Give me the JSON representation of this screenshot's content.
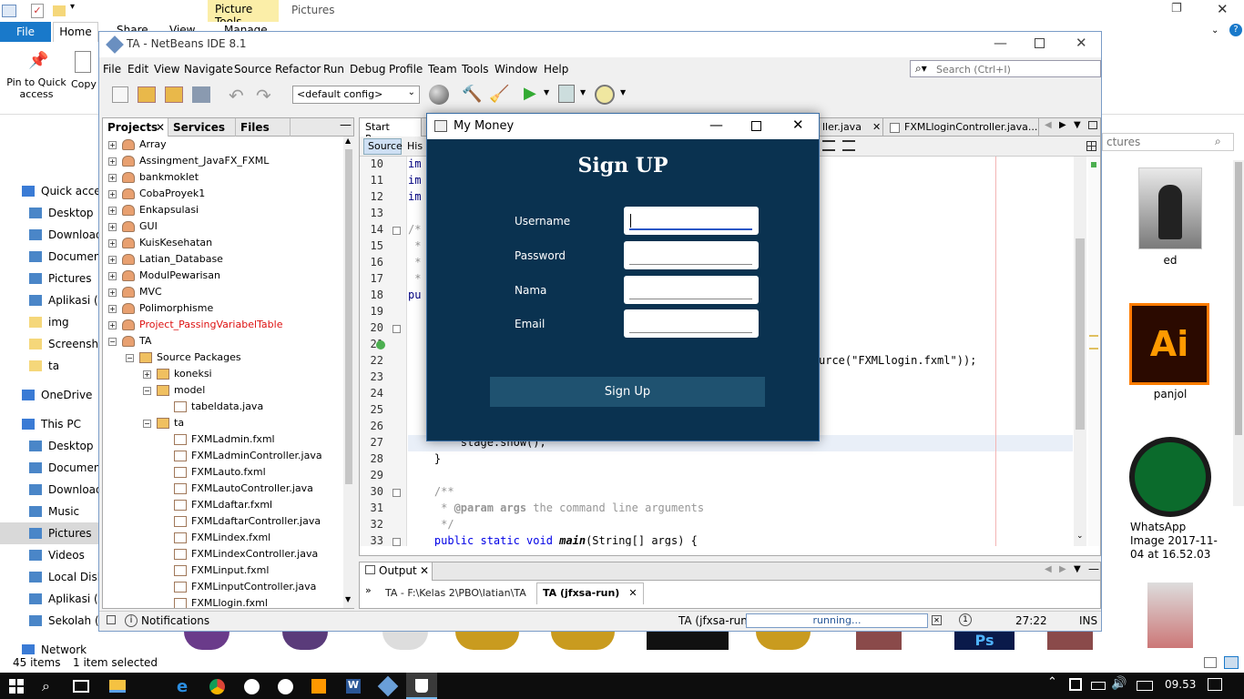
{
  "explorer": {
    "ribbon_tabs": {
      "file": "File",
      "home": "Home",
      "share": "Share",
      "view": "View",
      "manage": "Manage"
    },
    "contextual_tab": "Picture Tools",
    "window_title": "Pictures",
    "ribbon": {
      "pin_label": "Pin to Quick access",
      "copy_label": "Copy"
    },
    "nav": [
      {
        "label": "Quick access",
        "type": "header"
      },
      {
        "label": "Desktop"
      },
      {
        "label": "Downloads"
      },
      {
        "label": "Documents"
      },
      {
        "label": "Pictures"
      },
      {
        "label": "Aplikasi (E:"
      },
      {
        "label": "img"
      },
      {
        "label": "Screenshots"
      },
      {
        "label": "ta"
      },
      {
        "label": "OneDrive",
        "type": "header"
      },
      {
        "label": "This PC",
        "type": "header"
      },
      {
        "label": "Desktop"
      },
      {
        "label": "Documents"
      },
      {
        "label": "Downloads"
      },
      {
        "label": "Music"
      },
      {
        "label": "Pictures",
        "selected": true
      },
      {
        "label": "Videos"
      },
      {
        "label": "Local Disk"
      },
      {
        "label": "Aplikasi (E:"
      },
      {
        "label": "Sekolah (F:"
      },
      {
        "label": "Network",
        "type": "header"
      }
    ],
    "search_placeholder": "Search Pictures",
    "search_visible_text": "ctures",
    "files_right": [
      {
        "name": "ed"
      },
      {
        "name": "panjol"
      },
      {
        "name": "WhatsApp Image 2017-11-04 at 16.52.03"
      }
    ],
    "status": {
      "items": "45 items",
      "selected": "1 item selected"
    }
  },
  "netbeans": {
    "title": "TA - NetBeans IDE 8.1",
    "menu": [
      "File",
      "Edit",
      "View",
      "Navigate",
      "Source",
      "Refactor",
      "Run",
      "Debug",
      "Profile",
      "Team",
      "Tools",
      "Window",
      "Help"
    ],
    "search_placeholder": "Search (Ctrl+I)",
    "config_select": "<default config>",
    "project_tabs": [
      "Projects",
      "Services",
      "Files"
    ],
    "projects": [
      {
        "label": "Array"
      },
      {
        "label": "Assingment_JavaFX_FXML"
      },
      {
        "label": "bankmoklet"
      },
      {
        "label": "CobaProyek1"
      },
      {
        "label": "Enkapsulasi"
      },
      {
        "label": "GUI"
      },
      {
        "label": "KuisKesehatan"
      },
      {
        "label": "Latian_Database"
      },
      {
        "label": "ModulPewarisan"
      },
      {
        "label": "MVC"
      },
      {
        "label": "Polimorphisme"
      },
      {
        "label": "Project_PassingVariabelTable",
        "error": true
      },
      {
        "label": "TA",
        "expanded": true
      }
    ],
    "ta_tree": [
      {
        "label": "Source Packages",
        "level": 1
      },
      {
        "label": "koneksi",
        "level": 2
      },
      {
        "label": "model",
        "level": 2
      },
      {
        "label": "tabeldata.java",
        "level": 3
      },
      {
        "label": "ta",
        "level": 2
      },
      {
        "label": "FXMLadmin.fxml",
        "level": 3
      },
      {
        "label": "FXMLadminController.java",
        "level": 3
      },
      {
        "label": "FXMLauto.fxml",
        "level": 3
      },
      {
        "label": "FXMLautoController.java",
        "level": 3
      },
      {
        "label": "FXMLdaftar.fxml",
        "level": 3
      },
      {
        "label": "FXMLdaftarController.java",
        "level": 3
      },
      {
        "label": "FXMLindex.fxml",
        "level": 3
      },
      {
        "label": "FXMLindexController.java",
        "level": 3
      },
      {
        "label": "FXMLinput.fxml",
        "level": 3
      },
      {
        "label": "FXMLinputController.java",
        "level": 3
      },
      {
        "label": "FXMLlogin.fxml",
        "level": 3
      }
    ],
    "editor_tabs": {
      "start": "Start Page",
      "tab2": "ller.java",
      "tab3": "FXMLloginController.java..."
    },
    "source_tab": "Source",
    "history_tab": "His",
    "line_numbers": [
      "10",
      "11",
      "12",
      "13",
      "14",
      "15",
      "16",
      "17",
      "18",
      "19",
      "20",
      "21",
      "22",
      "23",
      "24",
      "25",
      "26",
      "27",
      "28",
      "29",
      "30",
      "31",
      "32",
      "33"
    ],
    "code": {
      "l10": "im",
      "l11": "im",
      "l12": "im",
      "l14": "/*",
      "l15": " *",
      "l16": " *",
      "l17": " *",
      "l18": "pu",
      "l22_suffix": "urce(\"FXMLlogin.fxml\"));",
      "l27": "        stage.show();",
      "l28": "    }",
      "l30": "    /**",
      "l31_pre": "     * ",
      "l31_tag": "@param",
      "l31_name": " args",
      "l31_rest": " the command line arguments",
      "l32": "     */",
      "l33_kw": "    public static void ",
      "l33_name": "main",
      "l33_rest": "(String[] args) {"
    },
    "output_tab": "Output",
    "output_runs": [
      "TA - F:\\Kelas 2\\PBO\\latian\\TA",
      "TA (jfxsa-run)"
    ],
    "status": {
      "notifications": "Notifications",
      "task": "TA (jfxsa-run)",
      "progress_text": "running...",
      "position": "27:22",
      "mode": "INS"
    }
  },
  "dialog": {
    "title": "My Money",
    "heading": "Sign UP",
    "fields": [
      {
        "label": "Username",
        "value": ""
      },
      {
        "label": "Password",
        "value": ""
      },
      {
        "label": "Nama",
        "value": ""
      },
      {
        "label": "Email",
        "value": ""
      }
    ],
    "button": "Sign Up",
    "colors": {
      "background": "#0a3250",
      "button": "#1f5270"
    }
  },
  "taskbar": {
    "time": "09.53"
  }
}
